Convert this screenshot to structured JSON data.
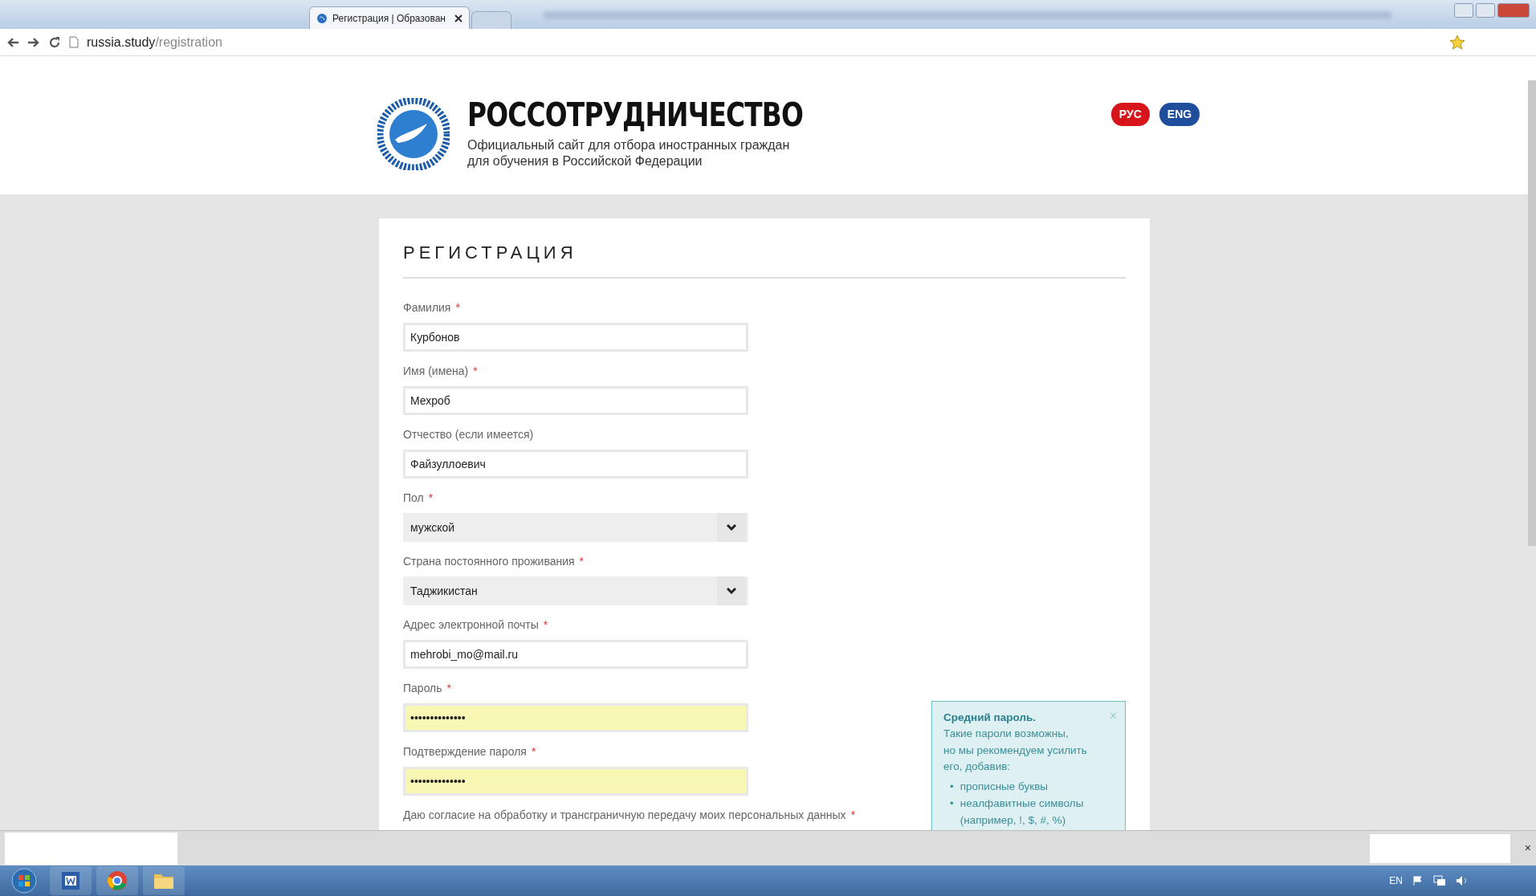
{
  "browser": {
    "tab_title": "Регистрация | Образован",
    "url_host": "russia.study",
    "url_path": "/registration"
  },
  "header": {
    "logo_title": "РОССОТРУДНИЧЕСТВО",
    "subtitle_lines": [
      "Официальный сайт для отбора иностранных граждан",
      "для обучения в Российской Федерации"
    ],
    "languages": [
      {
        "label": "РУС",
        "selected": true
      },
      {
        "label": "ENG",
        "selected": false
      }
    ]
  },
  "form": {
    "title": "РЕГИСТРАЦИЯ",
    "fields": [
      {
        "kind": "text",
        "label": "Фамилия",
        "required": true,
        "value": "Курбонов"
      },
      {
        "kind": "text",
        "label": "Имя (имена)",
        "required": true,
        "value": "Мехроб"
      },
      {
        "kind": "text",
        "label": "Отчество (если имеется)",
        "required": false,
        "value": "Файзуллоевич"
      },
      {
        "kind": "select",
        "label": "Пол",
        "required": true,
        "value": "мужской"
      },
      {
        "kind": "select",
        "label": "Страна постоянного проживания",
        "required": true,
        "value": "Таджикистан"
      },
      {
        "kind": "text",
        "label": "Адрес электронной почты",
        "required": true,
        "value": "mehrobi_mo@mail.ru"
      },
      {
        "kind": "password",
        "label": "Пароль",
        "required": true,
        "value": "••••••••••••••"
      },
      {
        "kind": "password",
        "label": "Подтверждение пароля",
        "required": true,
        "value": "••••••••••••••"
      }
    ],
    "required_mark": "*",
    "bullet": "•",
    "consent_label": "Даю согласие на обработку и трансграничную передачу моих персональных данных",
    "consent_required": true,
    "password_hint": {
      "title": "Средний пароль.",
      "text_lines": [
        "Такие пароли возможны,",
        "но мы рекомендуем усилить",
        "его, добавив:"
      ],
      "items": [
        "прописные буквы",
        "неалфавитные символы (например, !, $, #, %)"
      ],
      "close": "×"
    }
  },
  "taskbar": {
    "language": "EN"
  },
  "downloads_bar": {
    "close": "×"
  }
}
